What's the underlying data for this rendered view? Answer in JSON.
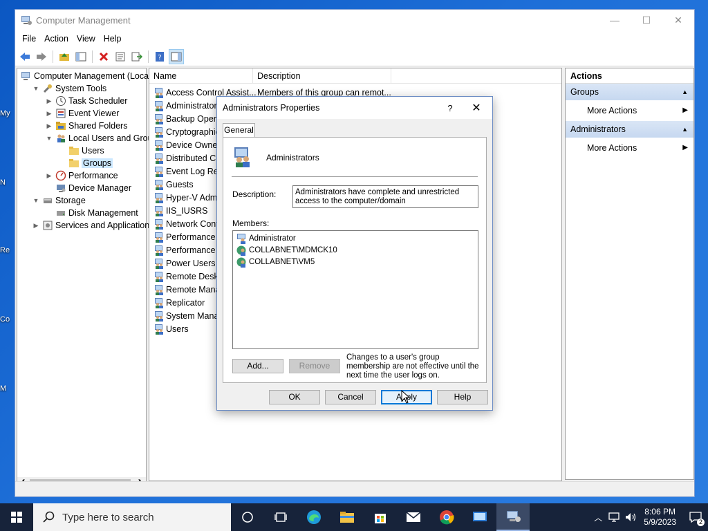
{
  "window": {
    "title": "Computer Management",
    "menu": [
      "File",
      "Action",
      "View",
      "Help"
    ]
  },
  "tree": {
    "items": [
      {
        "label": "Computer Management (Local",
        "level": 0,
        "arrow": "",
        "icon": "computer-icon"
      },
      {
        "label": "System Tools",
        "level": 1,
        "arrow": "expanded",
        "icon": "tools-icon"
      },
      {
        "label": "Task Scheduler",
        "level": 2,
        "arrow": "collapsed",
        "icon": "clock-icon"
      },
      {
        "label": "Event Viewer",
        "level": 2,
        "arrow": "collapsed",
        "icon": "event-viewer-icon"
      },
      {
        "label": "Shared Folders",
        "level": 2,
        "arrow": "collapsed",
        "icon": "shared-folder-icon"
      },
      {
        "label": "Local Users and Groups",
        "level": 2,
        "arrow": "expanded",
        "icon": "users-icon"
      },
      {
        "label": "Users",
        "level": 3,
        "arrow": "",
        "icon": "folder-icon"
      },
      {
        "label": "Groups",
        "level": 3,
        "arrow": "",
        "icon": "folder-icon",
        "selected": true
      },
      {
        "label": "Performance",
        "level": 2,
        "arrow": "collapsed",
        "icon": "performance-icon"
      },
      {
        "label": "Device Manager",
        "level": 2,
        "arrow": "",
        "icon": "device-manager-icon"
      },
      {
        "label": "Storage",
        "level": 1,
        "arrow": "expanded",
        "icon": "storage-icon"
      },
      {
        "label": "Disk Management",
        "level": 2,
        "arrow": "",
        "icon": "disk-icon"
      },
      {
        "label": "Services and Applications",
        "level": 1,
        "arrow": "collapsed",
        "icon": "services-icon"
      }
    ]
  },
  "list": {
    "headers": [
      "Name",
      "Description"
    ],
    "rows": [
      {
        "name": "Access Control Assist...",
        "desc": "Members of this group can remot..."
      },
      {
        "name": "Administrators",
        "desc": ""
      },
      {
        "name": "Backup Operat",
        "desc": ""
      },
      {
        "name": "Cryptographic",
        "desc": ""
      },
      {
        "name": "Device Owners",
        "desc": ""
      },
      {
        "name": "Distributed CO",
        "desc": ""
      },
      {
        "name": "Event Log Rea",
        "desc": ""
      },
      {
        "name": "Guests",
        "desc": ""
      },
      {
        "name": "Hyper-V Admi",
        "desc": ""
      },
      {
        "name": "IIS_IUSRS",
        "desc": ""
      },
      {
        "name": "Network Conf",
        "desc": ""
      },
      {
        "name": "Performance L",
        "desc": ""
      },
      {
        "name": "Performance M",
        "desc": ""
      },
      {
        "name": "Power Users",
        "desc": ""
      },
      {
        "name": "Remote Deskto",
        "desc": ""
      },
      {
        "name": "Remote Mana",
        "desc": ""
      },
      {
        "name": "Replicator",
        "desc": ""
      },
      {
        "name": "System Manag",
        "desc": ""
      },
      {
        "name": "Users",
        "desc": ""
      }
    ]
  },
  "actions": {
    "header": "Actions",
    "groups": [
      {
        "title": "Groups",
        "item": "More Actions"
      },
      {
        "title": "Administrators",
        "item": "More Actions"
      }
    ]
  },
  "dialog": {
    "title": "Administrators Properties",
    "help": "?",
    "close": "✕",
    "tab": "General",
    "group_name": "Administrators",
    "description_label": "Description:",
    "description_value": "Administrators have complete and unrestricted access to the computer/domain",
    "members_label": "Members:",
    "members": [
      {
        "name": "Administrator",
        "icon": "user-icon"
      },
      {
        "name": "COLLABNET\\MDMCK10",
        "icon": "domain-user-icon"
      },
      {
        "name": "COLLABNET\\VM5",
        "icon": "domain-user-icon"
      }
    ],
    "add_label": "Add...",
    "remove_label": "Remove",
    "note": "Changes to a user's group membership are not effective until the next time the user logs on.",
    "ok_label": "OK",
    "cancel_label": "Cancel",
    "apply_label": "Apply",
    "help_label": "Help"
  },
  "taskbar": {
    "search_placeholder": "Type here to search",
    "time": "8:06 PM",
    "date": "5/9/2023",
    "notification_count": "2"
  },
  "desktop_labels": [
    "My",
    "N",
    "Re",
    "Co",
    "M"
  ]
}
